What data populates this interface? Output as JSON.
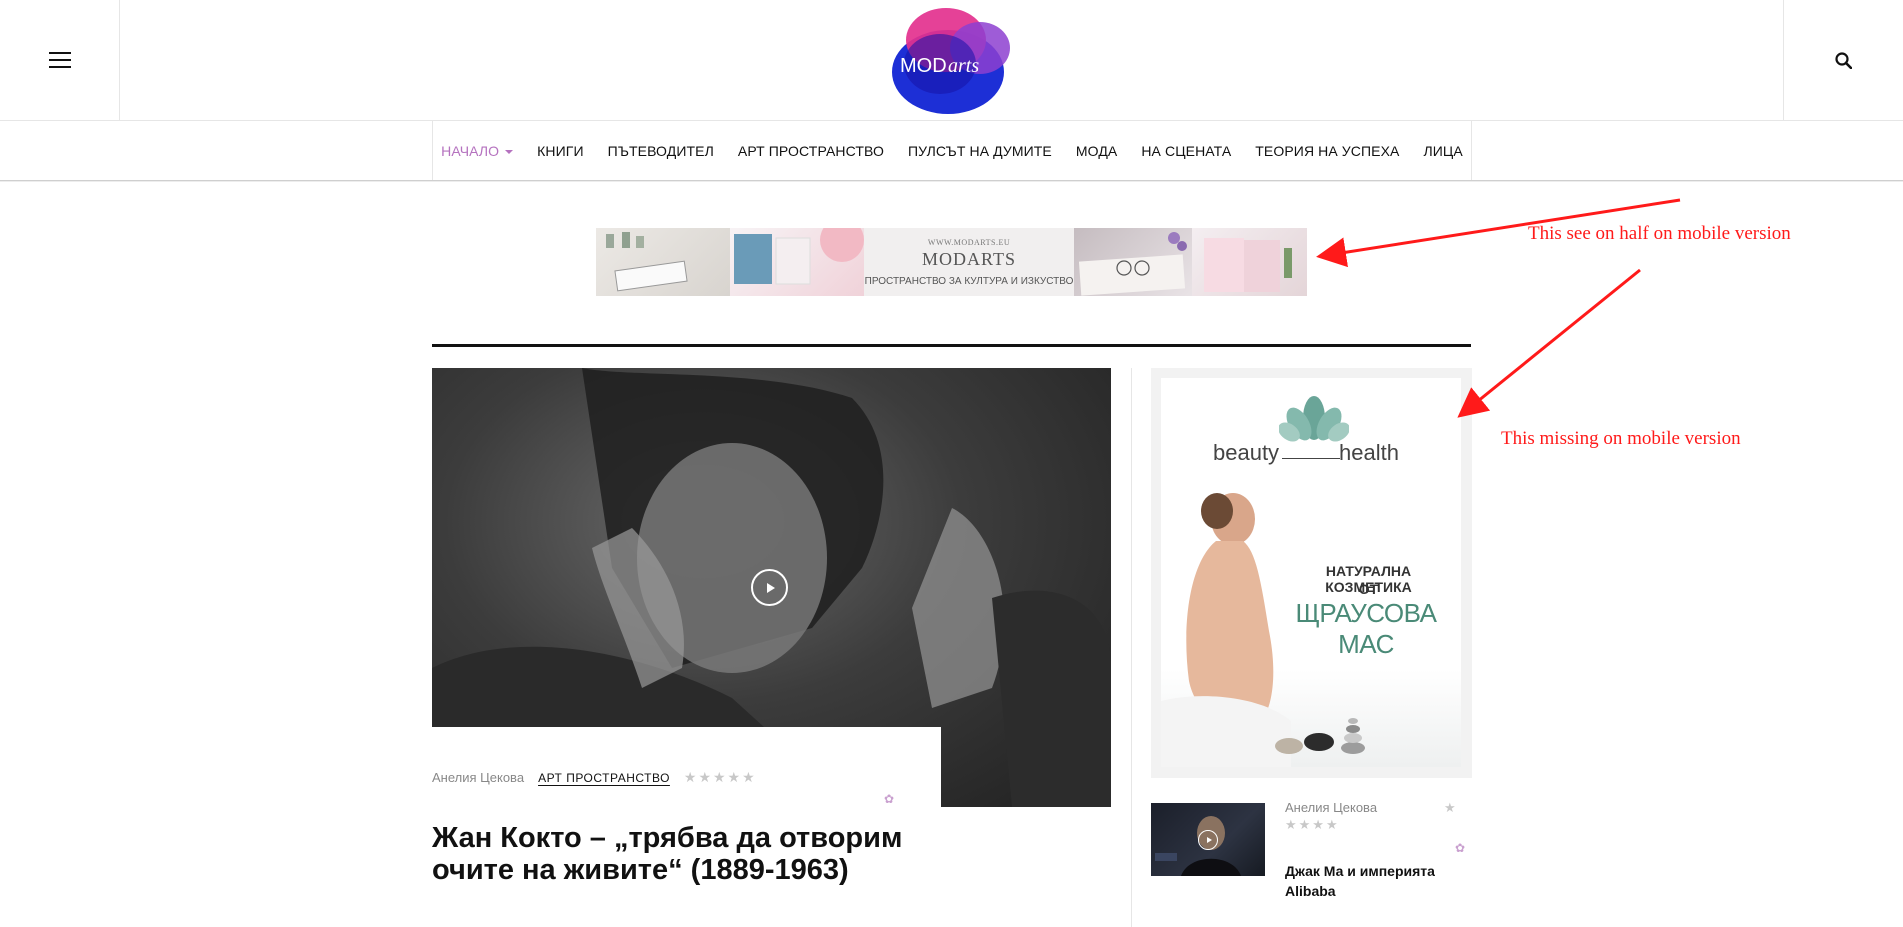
{
  "header": {
    "logo_text_a": "MOD",
    "logo_text_b": "arts",
    "menu_icon": "hamburger-menu-icon",
    "search_icon": "search-icon"
  },
  "nav": {
    "items": [
      {
        "label": "НАЧАЛО",
        "active": true
      },
      {
        "label": "КНИГИ"
      },
      {
        "label": "ПЪТЕВОДИТЕЛ"
      },
      {
        "label": "АРТ ПРОСТРАНСТВО"
      },
      {
        "label": "ПУЛСЪТ НА ДУМИТЕ"
      },
      {
        "label": "МОДА"
      },
      {
        "label": "НА СЦЕНАТА"
      },
      {
        "label": "ТЕОРИЯ НА УСПЕХА"
      },
      {
        "label": "ЛИЦА"
      }
    ],
    "accent_color": "#b572bf"
  },
  "top_banner": {
    "url_text": "WWW.MODARTS.EU",
    "title": "MODARTS",
    "subtitle": "ПРОСТРАНСТВО ЗА КУЛТУРА И ИЗКУСТВО"
  },
  "feature": {
    "author": "Анелия Цекова",
    "category": "АРТ ПРОСТРАНСТВО",
    "rating_stars": "★★★★★",
    "title": "Жан Кокто – „трябва да отворим очите на живите“ (1889-1963)"
  },
  "side_ad": {
    "brand_left": "beauty",
    "brand_right": "health",
    "line1": "НАТУРАЛНА КОЗМЕТИКА",
    "line2": "ОТ",
    "line3": "ЩРАУСОВА МАС"
  },
  "side_post": {
    "author": "Анелия Цекова",
    "rating_stars": "★★★★",
    "rating_star_right": "★",
    "title": "Джак Ма и империята Alibaba"
  },
  "annotations": {
    "note1": "This see on half on mobile version",
    "note2": "This missing on mobile version",
    "color": "#ff1a1a"
  }
}
